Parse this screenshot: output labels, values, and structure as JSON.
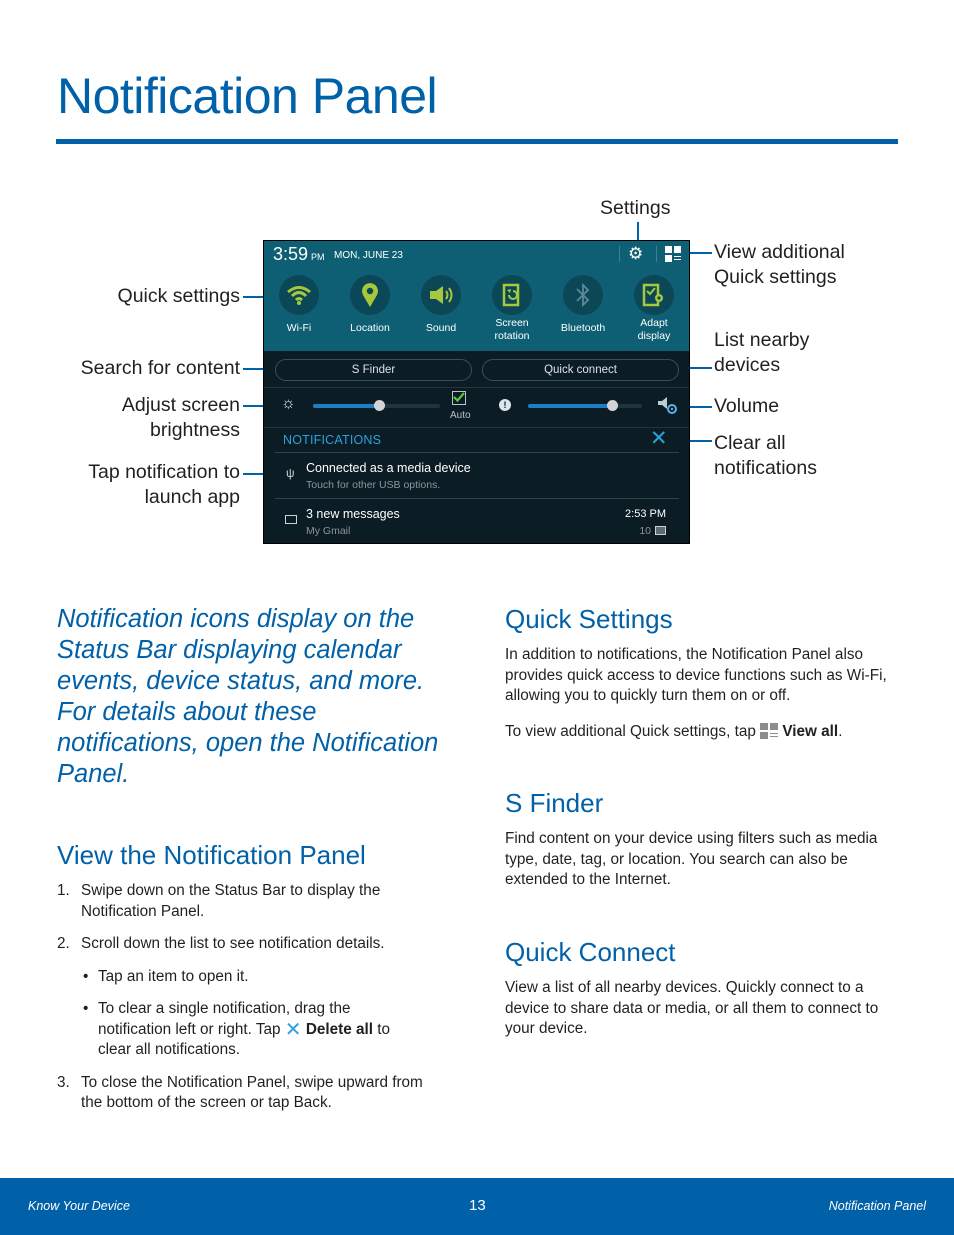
{
  "page": {
    "title": "Notification Panel"
  },
  "callouts": {
    "settings": "Settings",
    "view_additional_line1": "View additional",
    "view_additional_line2": "Quick settings",
    "quick_settings": "Quick settings",
    "search_for_content": "Search for content",
    "adjust_brightness_line1": "Adjust screen",
    "adjust_brightness_line2": "brightness",
    "tap_notification_line1": "Tap notification to",
    "tap_notification_line2": "launch app",
    "list_nearby_line1": "List nearby",
    "list_nearby_line2": "devices",
    "volume": "Volume",
    "clear_all_line1": "Clear all",
    "clear_all_line2": "notifications"
  },
  "panel": {
    "time": "3:59",
    "ampm": "PM",
    "date": "MON, JUNE 23",
    "quick_settings": [
      {
        "label_line1": "Wi-Fi",
        "label_line2": "",
        "icon": "wifi-icon"
      },
      {
        "label_line1": "Location",
        "label_line2": "",
        "icon": "location-icon"
      },
      {
        "label_line1": "Sound",
        "label_line2": "",
        "icon": "sound-icon"
      },
      {
        "label_line1": "Screen",
        "label_line2": "rotation",
        "icon": "screen-rotation-icon"
      },
      {
        "label_line1": "Bluetooth",
        "label_line2": "",
        "icon": "bluetooth-icon"
      },
      {
        "label_line1": "Adapt",
        "label_line2": "display",
        "icon": "adapt-display-icon"
      }
    ],
    "s_finder_label": "S Finder",
    "quick_connect_label": "Quick connect",
    "brightness": {
      "value_percent": 52,
      "auto_label": "Auto",
      "auto_checked": true
    },
    "volume": {
      "value_percent": 74
    },
    "notifications_header": "NOTIFICATIONS",
    "notifications": [
      {
        "title": "Connected as a media device",
        "subtitle": "Touch for other USB options.",
        "time": "",
        "count": ""
      },
      {
        "title": "3 new messages",
        "subtitle": "My Gmail",
        "time": "2:53 PM",
        "count": "10"
      }
    ],
    "colors": {
      "active_icon": "#a6c83a",
      "inactive_icon": "#5b8a96",
      "accent": "#2aa3df"
    }
  },
  "lead": "Notification icons display on the Status Bar displaying calendar events, device status, and more. For details about these notifications, open the Notification Panel.",
  "view_panel": {
    "heading": "View the Notification Panel",
    "step1_num": "1.",
    "step1": "Swipe down on the Status Bar to display the Notification Panel.",
    "step2_num": "2.",
    "step2": "Scroll down the list to see notification details.",
    "bullet1": "Tap an item to open it.",
    "bullet2_pre": "To clear a single notification, drag the notification left or right. Tap",
    "bullet2_bold": "Delete all",
    "bullet2_post": "to clear all notifications.",
    "step3_num": "3.",
    "step3": "To close the Notification Panel, swipe upward from the bottom of the screen or tap  Back."
  },
  "quick_settings_section": {
    "heading": "Quick Settings",
    "para1": "In addition to notifications, the Notification Panel also provides quick access to device functions such as Wi-Fi, allowing you to quickly turn them on or off.",
    "para2_pre": "To view additional Quick settings, tap",
    "para2_bold": "View all",
    "para2_post": "."
  },
  "s_finder_section": {
    "heading": "S Finder",
    "para": "Find content on your device using filters such as media type, date, tag, or location. You search can also be extended to the Internet."
  },
  "quick_connect_section": {
    "heading": "Quick Connect",
    "para": "View a list of all nearby devices. Quickly connect to a device to share data or media, or all them to connect to your device."
  },
  "footer": {
    "left": "Know Your Device",
    "page_number": "13",
    "right": "Notification Panel"
  }
}
